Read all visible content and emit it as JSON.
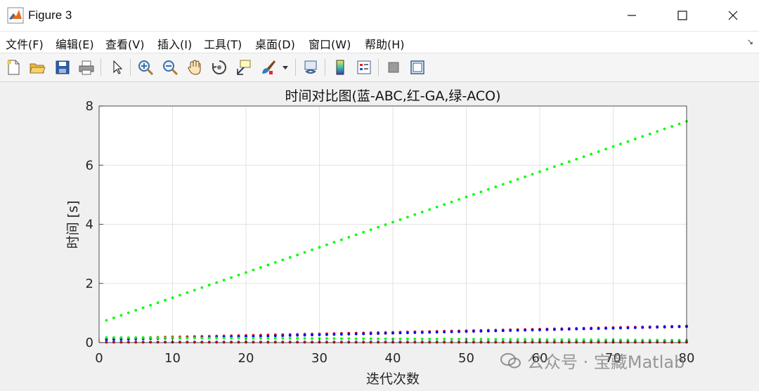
{
  "window": {
    "title": "Figure 3"
  },
  "menu": [
    "文件(F)",
    "编辑(E)",
    "查看(V)",
    "插入(I)",
    "工具(T)",
    "桌面(D)",
    "窗口(W)",
    "帮助(H)"
  ],
  "toolbar_icons": [
    "new-figure-icon",
    "open-file-icon",
    "save-icon",
    "print-icon",
    "pointer-icon",
    "zoom-in-icon",
    "zoom-out-icon",
    "pan-hand-icon",
    "rotate-3d-icon",
    "data-cursor-icon",
    "brush-icon",
    "brush-dropdown-icon",
    "link-plot-icon",
    "colorbar-icon",
    "legend-icon",
    "hide-plot-tools-icon",
    "show-plot-tools-icon"
  ],
  "watermark": "公众号 · 宝藏Matlab",
  "chart_data": {
    "type": "scatter",
    "title": "时间对比图(蓝-ABC,红-GA,绿-ACO)",
    "xlabel": "迭代次数",
    "ylabel": "时间 [s]",
    "xlim": [
      0,
      80
    ],
    "ylim": [
      0,
      8
    ],
    "xticks": [
      0,
      10,
      20,
      30,
      40,
      50,
      60,
      70,
      80
    ],
    "yticks": [
      0,
      2,
      4,
      6,
      8
    ],
    "grid": true,
    "series": [
      {
        "color": "#00ff00",
        "x_range": [
          1,
          80
        ],
        "y_start": 0.75,
        "y_end": 7.48
      },
      {
        "color": "#ff0000",
        "x_range": [
          1,
          80
        ],
        "y_start": 0.14,
        "y_end": 0.56
      },
      {
        "color": "#0000ff",
        "x_range": [
          1,
          80
        ],
        "y_start": 0.1,
        "y_end": 0.54
      },
      {
        "color": "#00ff00",
        "x_range": [
          1,
          80
        ],
        "y_start": 0.17,
        "y_end": 0.08
      },
      {
        "color": "#0000ff",
        "x_range": [
          1,
          80
        ],
        "y_start": 0.02,
        "y_end": 0.02
      },
      {
        "color": "#ff0000",
        "x_range": [
          1,
          80
        ],
        "y_start": 0.01,
        "y_end": 0.01
      }
    ]
  }
}
